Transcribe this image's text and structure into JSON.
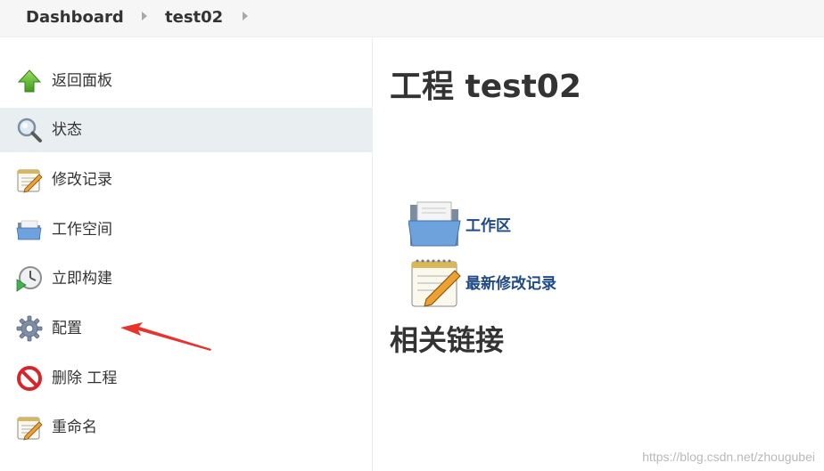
{
  "breadcrumb": {
    "items": [
      "Dashboard",
      "test02"
    ]
  },
  "sidebar": {
    "items": [
      {
        "label": "返回面板",
        "icon": "up-arrow-icon"
      },
      {
        "label": "状态",
        "icon": "magnifier-icon",
        "active": true
      },
      {
        "label": "修改记录",
        "icon": "notepad-icon"
      },
      {
        "label": "工作空间",
        "icon": "folder-icon"
      },
      {
        "label": "立即构建",
        "icon": "clock-play-icon"
      },
      {
        "label": "配置",
        "icon": "gear-icon"
      },
      {
        "label": "删除 工程",
        "icon": "no-entry-icon"
      },
      {
        "label": "重命名",
        "icon": "notepad-icon"
      }
    ]
  },
  "main": {
    "title": "工程 test02",
    "links": [
      {
        "label": "工作区",
        "icon": "folder-icon"
      },
      {
        "label": "最新修改记录",
        "icon": "notepad-icon"
      }
    ],
    "related_title": "相关链接"
  },
  "colors": {
    "accent_link": "#204a87",
    "active_row": "#e9eef1",
    "annotation_arrow": "#e8322d"
  },
  "watermark": "https://blog.csdn.net/zhougubei"
}
